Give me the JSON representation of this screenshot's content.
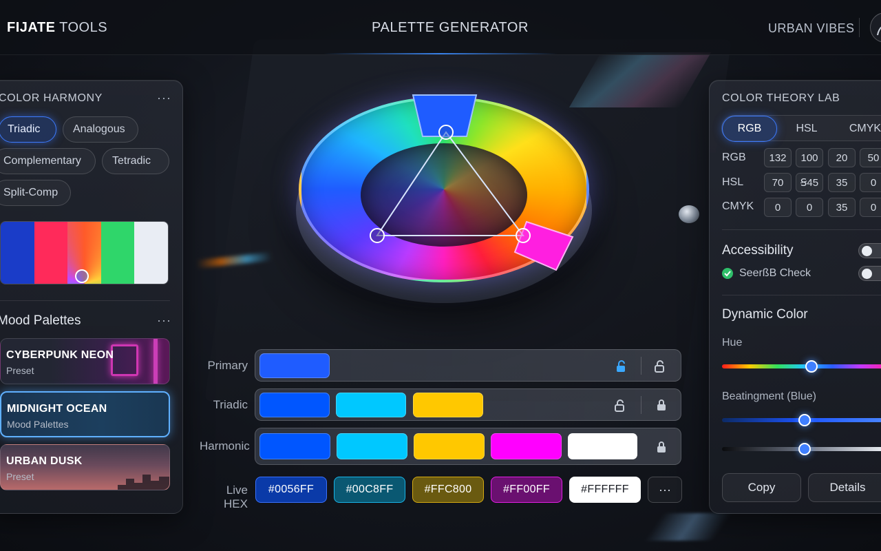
{
  "header": {
    "brand_bold": "FIJATE",
    "brand_rest": "TOOLS",
    "title": "PALETTE GENERATOR",
    "theme": "URBAN VIBES"
  },
  "harmony": {
    "title": "COLOR HARMONY",
    "more": "···",
    "chips": [
      "Triadic",
      "Analogous",
      "Complementary",
      "Tetradic",
      "Split-Comp"
    ],
    "active": "Triadic",
    "spectrum_colors": [
      "#1a3cc8",
      "#ff2a5a",
      "#ffd13a",
      "#2fd66a",
      "#e9edf4"
    ]
  },
  "moods": {
    "title": "Mood Palettes",
    "more": "···",
    "items": [
      {
        "name": "CYBERPUNK NEON",
        "sub": "Preset"
      },
      {
        "name": "MIDNIGHT OCEAN",
        "sub": "Mood Palettes"
      },
      {
        "name": "URBAN DUSK",
        "sub": "Preset"
      }
    ]
  },
  "rows": {
    "primary_label": "Primary",
    "triadic_label": "Triadic",
    "harmonic_label": "Harmonic",
    "hex_label": "Live HEX",
    "primary": [
      "#1f5cff"
    ],
    "triadic": [
      "#0056ff",
      "#00c8ff",
      "#ffc800"
    ],
    "harmonic": [
      "#0056ff",
      "#00c8ff",
      "#ffc800",
      "#ff00ff",
      "#ffffff"
    ],
    "hex_values": [
      "#0056FF",
      "#00C8FF",
      "#FFC800",
      "#FF00FF",
      "#FFFFFF"
    ],
    "hex_more": "···"
  },
  "lab": {
    "title": "COLOR THEORY LAB",
    "modes": [
      "RGB",
      "HSL",
      "CMYK"
    ],
    "active_mode": "RGB",
    "rgb_label": "RGB",
    "rgb": [
      "132",
      "100",
      "20",
      "50"
    ],
    "hsl_label": "HSL",
    "hsl": [
      "70",
      "Ꞩ45",
      "35",
      "0"
    ],
    "cmyk_label": "CMYK",
    "cmyk": [
      "0",
      "0",
      "35",
      "0"
    ]
  },
  "accessibility": {
    "title": "Accessibility",
    "check_label": "SeerßB Check",
    "toggle_on": false,
    "check_on": false
  },
  "dynamic": {
    "title": "Dynamic Color",
    "hue_label": "Hue",
    "hue_value": 0.54,
    "beat_label": "Beatingment (Blue)",
    "beat_value": 0.5,
    "third_value": 0.5
  },
  "actions": {
    "copy": "Copy",
    "details": "Details"
  },
  "colors": {
    "accent": "#3d7bff",
    "blue": "#0056ff",
    "cyan": "#00c8ff",
    "yellow": "#ffc800",
    "magenta": "#ff00ff",
    "white": "#ffffff"
  }
}
